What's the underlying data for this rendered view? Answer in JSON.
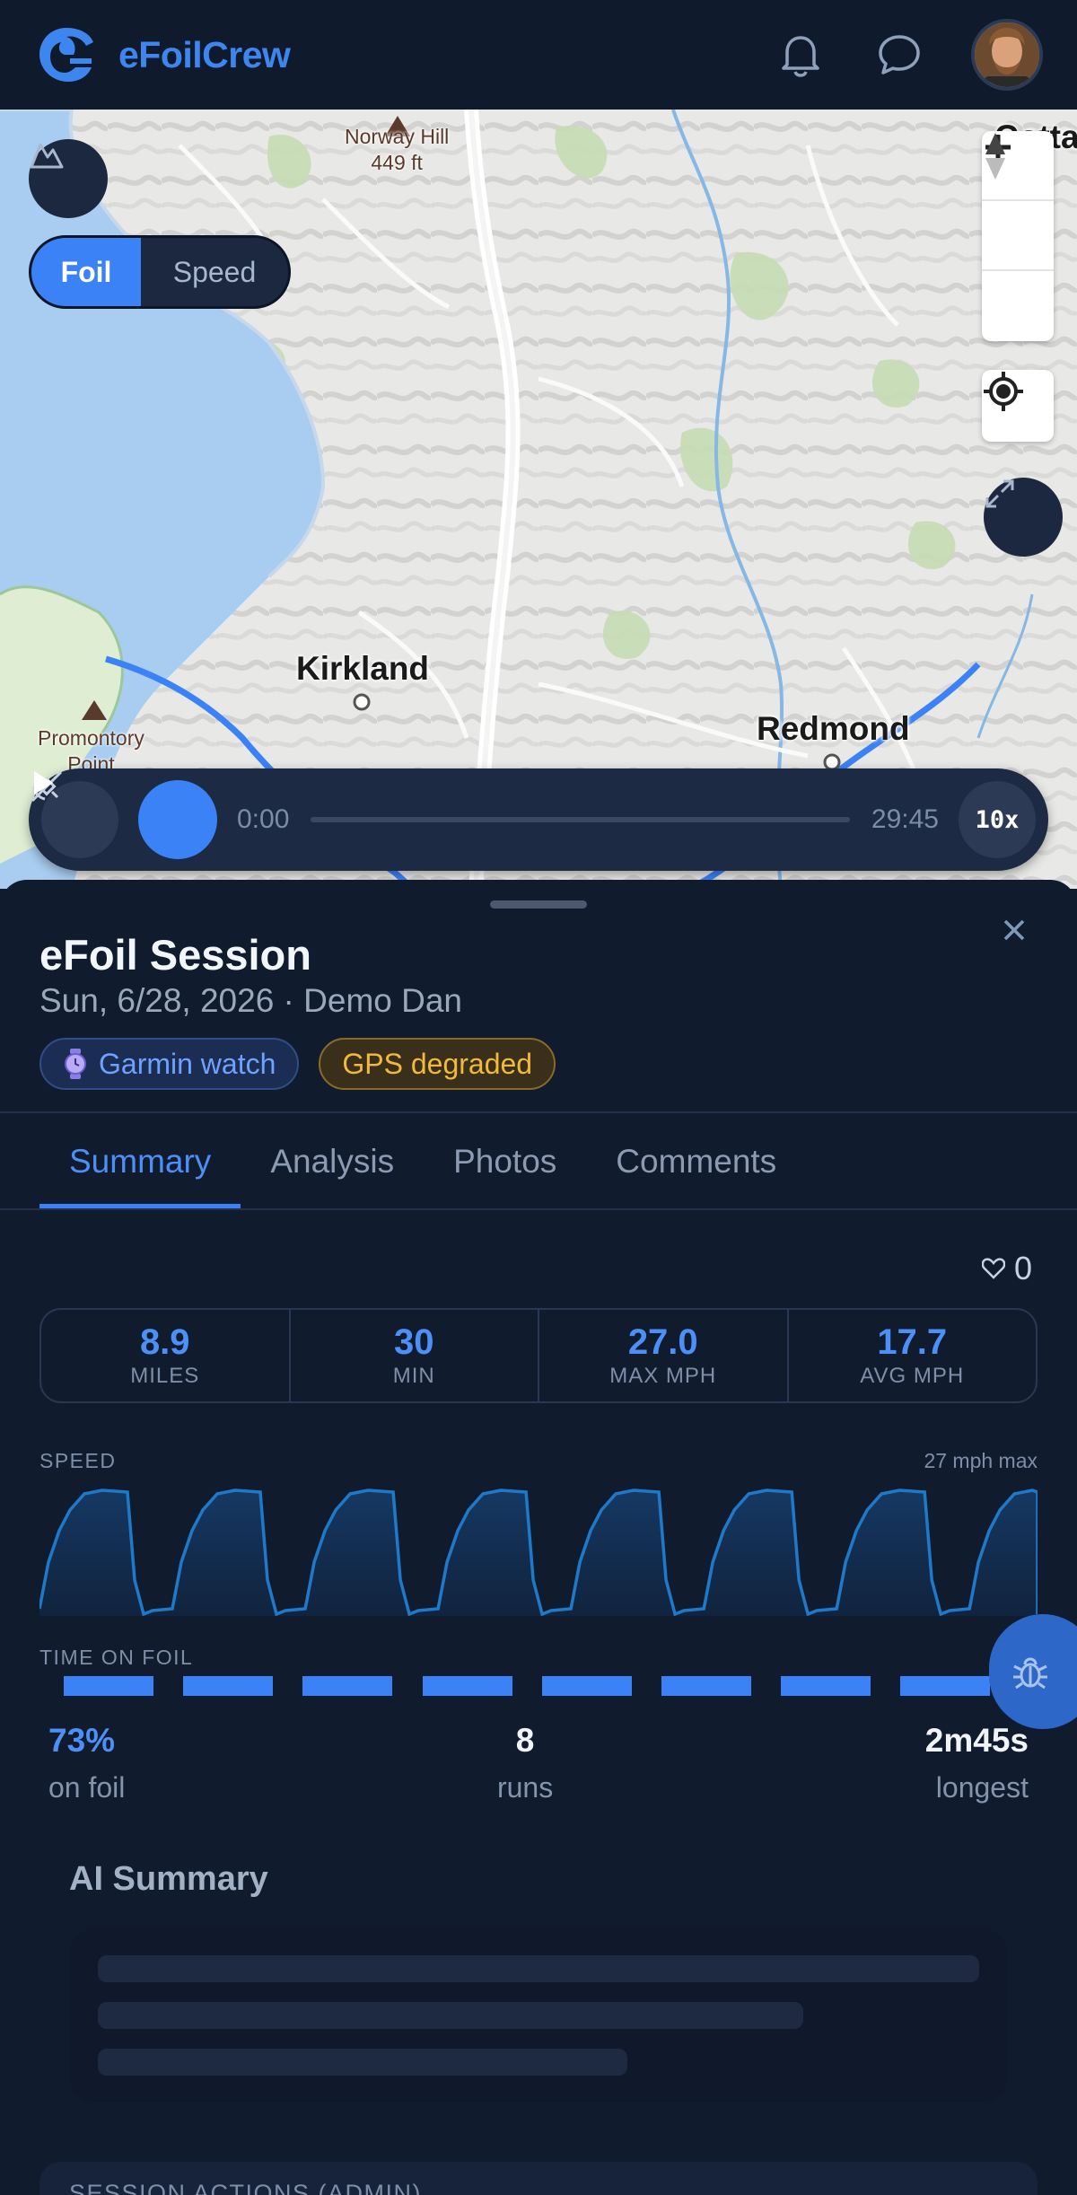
{
  "header": {
    "brand": "eFoilCrew",
    "icons": [
      "bell-icon",
      "chat-icon",
      "avatar"
    ]
  },
  "map": {
    "labels": {
      "kirkland": "Kirkland",
      "redmond": "Redmond",
      "norway_hill": "Norway Hill",
      "norway_hill_elev": "449 ft",
      "promontory": "Promontory",
      "promontory_2": "Point",
      "cottage_partial": "Cottag"
    },
    "mode_toggle": {
      "options": [
        "Foil",
        "Speed"
      ],
      "selected": "Foil"
    },
    "zoom": {
      "in": "+",
      "out": "−"
    },
    "route_color": "#3b82f6"
  },
  "player": {
    "current_time": "0:00",
    "total_time": "29:45",
    "playback_speed": "10x",
    "progress": 0
  },
  "session": {
    "title": "eFoil Session",
    "subtitle": "Sun, 6/28, 2026 · Demo Dan",
    "chips": {
      "device": "Garmin watch",
      "warning": "GPS degraded"
    }
  },
  "tabs": [
    "Summary",
    "Analysis",
    "Photos",
    "Comments"
  ],
  "active_tab": "Summary",
  "likes": "0",
  "stats": [
    {
      "value": "8.9",
      "label": "MILES"
    },
    {
      "value": "30",
      "label": "MIN"
    },
    {
      "value": "27.0",
      "label": "MAX MPH"
    },
    {
      "value": "17.7",
      "label": "AVG MPH"
    }
  ],
  "speed_section": {
    "label": "SPEED",
    "max_note": "27 mph max"
  },
  "foil_section": {
    "label": "TIME ON FOIL",
    "runs_count": 8
  },
  "foil_stats": {
    "pct": {
      "value": "73%",
      "label": "on foil"
    },
    "runs": {
      "value": "8",
      "label": "runs"
    },
    "longest": {
      "value": "2m45s",
      "label": "longest"
    }
  },
  "ai_summary": {
    "title": "AI Summary"
  },
  "admin": {
    "title": "SESSION ACTIONS (ADMIN)"
  },
  "colors": {
    "accent": "#3b82f6",
    "background": "#111b2e",
    "warning": "#f2b93b"
  }
}
